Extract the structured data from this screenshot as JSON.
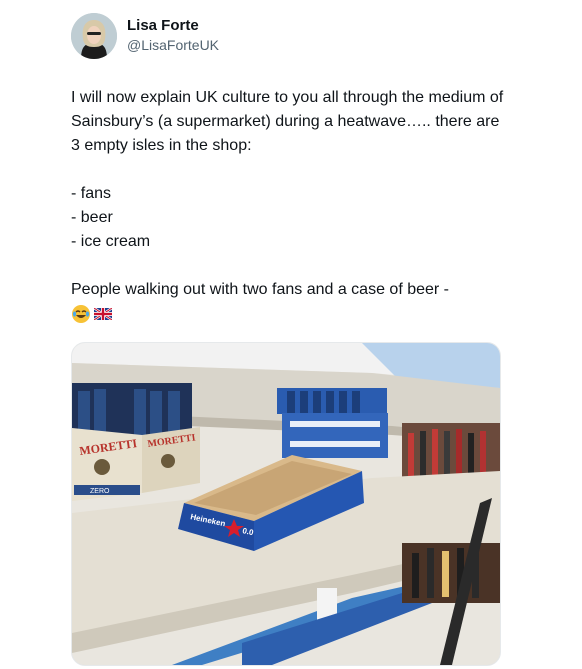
{
  "author": {
    "name": "Lisa Forte",
    "handle": "@LisaForteUK"
  },
  "tweet": {
    "paragraph1": "I will now explain UK culture to you all through the medium of Sainsbury’s (a supermarket) during a heatwave….. there are 3 empty isles in the shop:",
    "list": [
      "- fans",
      "- beer",
      "- ice cream"
    ],
    "paragraph2": "People walking out with two fans and a case of beer -",
    "emojis": [
      "face-with-tears-of-joy-icon",
      "uk-flag-icon"
    ]
  },
  "photo": {
    "description_icon": "empty-supermarket-shelves-photo",
    "box_text_left": "MORETTI",
    "box_text_right": "MORETTI",
    "zero_label": "ZERO",
    "tray_brand": "Heineken",
    "tray_strength": "0.0",
    "colors": {
      "shelf": "#ebe7de",
      "heineken_blue": "#1f4aa0",
      "moretti_red": "#b7322b",
      "cardboard": "#d9b98a"
    }
  }
}
